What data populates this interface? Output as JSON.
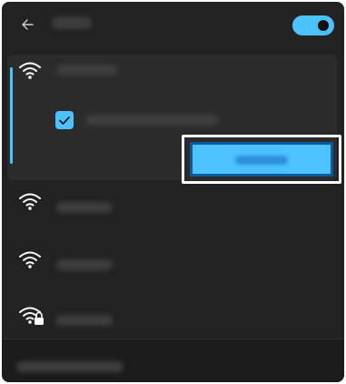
{
  "colors": {
    "accent": "#4cc2ff",
    "panel": "#222222"
  },
  "header": {
    "back_icon": "arrow-left-icon",
    "title": ""
  },
  "wifi_toggle": {
    "on": true
  },
  "networks": [
    {
      "icon": "wifi-icon",
      "name": "",
      "expanded": true,
      "connect_auto_checked": true,
      "connect_auto_label": "",
      "connect_label": ""
    },
    {
      "icon": "wifi-icon",
      "name": ""
    },
    {
      "icon": "wifi-icon",
      "name": ""
    },
    {
      "icon": "wifi-lock-icon",
      "name": ""
    }
  ],
  "footer": {
    "link_label": ""
  }
}
